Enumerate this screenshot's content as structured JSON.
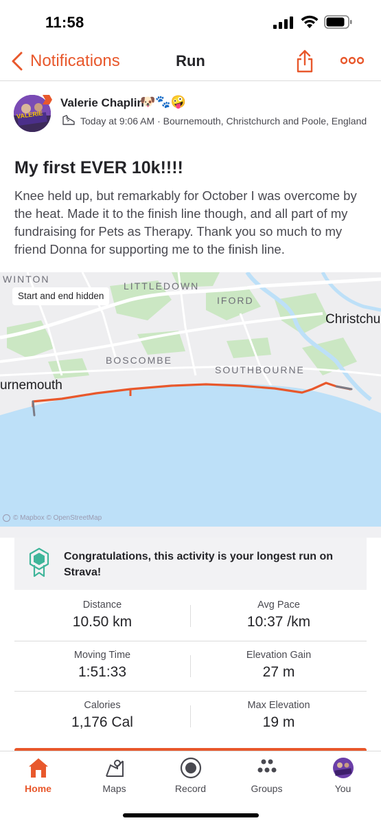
{
  "status_bar": {
    "time": "11:58"
  },
  "header": {
    "back_label": "Notifications",
    "title": "Run"
  },
  "author": {
    "name": "Valerie Chaplin",
    "emoji": "🐶🐾🤪",
    "avatar_text": "VALERIE"
  },
  "activity": {
    "meta": "Today at 9:06 AM · Bournemouth, Christchurch and Poole, England",
    "title": "My first EVER 10k!!!!",
    "description": "Knee held up, but remarkably for October I was overcome by the heat. Made it to the finish line though, and all part of my fundraising for Pets as Therapy. Thank you so much to my friend Donna for supporting me to the finish line."
  },
  "map": {
    "hidden_label": "Start and end hidden",
    "places": {
      "winton": "WINTON",
      "littledown": "LITTLEDOWN",
      "iford": "IFORD",
      "boscombe": "BOSCOMBE",
      "southbourne": "SOUTHBOURNE",
      "bournemouth": "urnemouth",
      "christchurch": "Christchu"
    },
    "attribution": "© Mapbox © OpenStreetMap",
    "route_color": "#e8582c",
    "sea_color": "#bde0f8",
    "land_color": "#eeeef0",
    "park_color": "#cbe7c3"
  },
  "achievement": {
    "text": "Congratulations, this activity is your longest run on Strava!"
  },
  "stats": [
    {
      "left_label": "Distance",
      "left_value": "10.50 km",
      "right_label": "Avg Pace",
      "right_value": "10:37 /km"
    },
    {
      "left_label": "Moving Time",
      "left_value": "1:51:33",
      "right_label": "Elevation Gain",
      "right_value": "27 m"
    },
    {
      "left_label": "Calories",
      "left_value": "1,176 Cal",
      "right_label": "Max Elevation",
      "right_value": "19 m"
    }
  ],
  "tabs": [
    {
      "label": "Home",
      "icon": "home-icon",
      "active": true
    },
    {
      "label": "Maps",
      "icon": "maps-icon"
    },
    {
      "label": "Record",
      "icon": "record-icon"
    },
    {
      "label": "Groups",
      "icon": "groups-icon"
    },
    {
      "label": "You",
      "icon": "avatar-icon"
    }
  ],
  "colors": {
    "accent": "#e8582c",
    "text": "#242428",
    "muted": "#494950"
  }
}
